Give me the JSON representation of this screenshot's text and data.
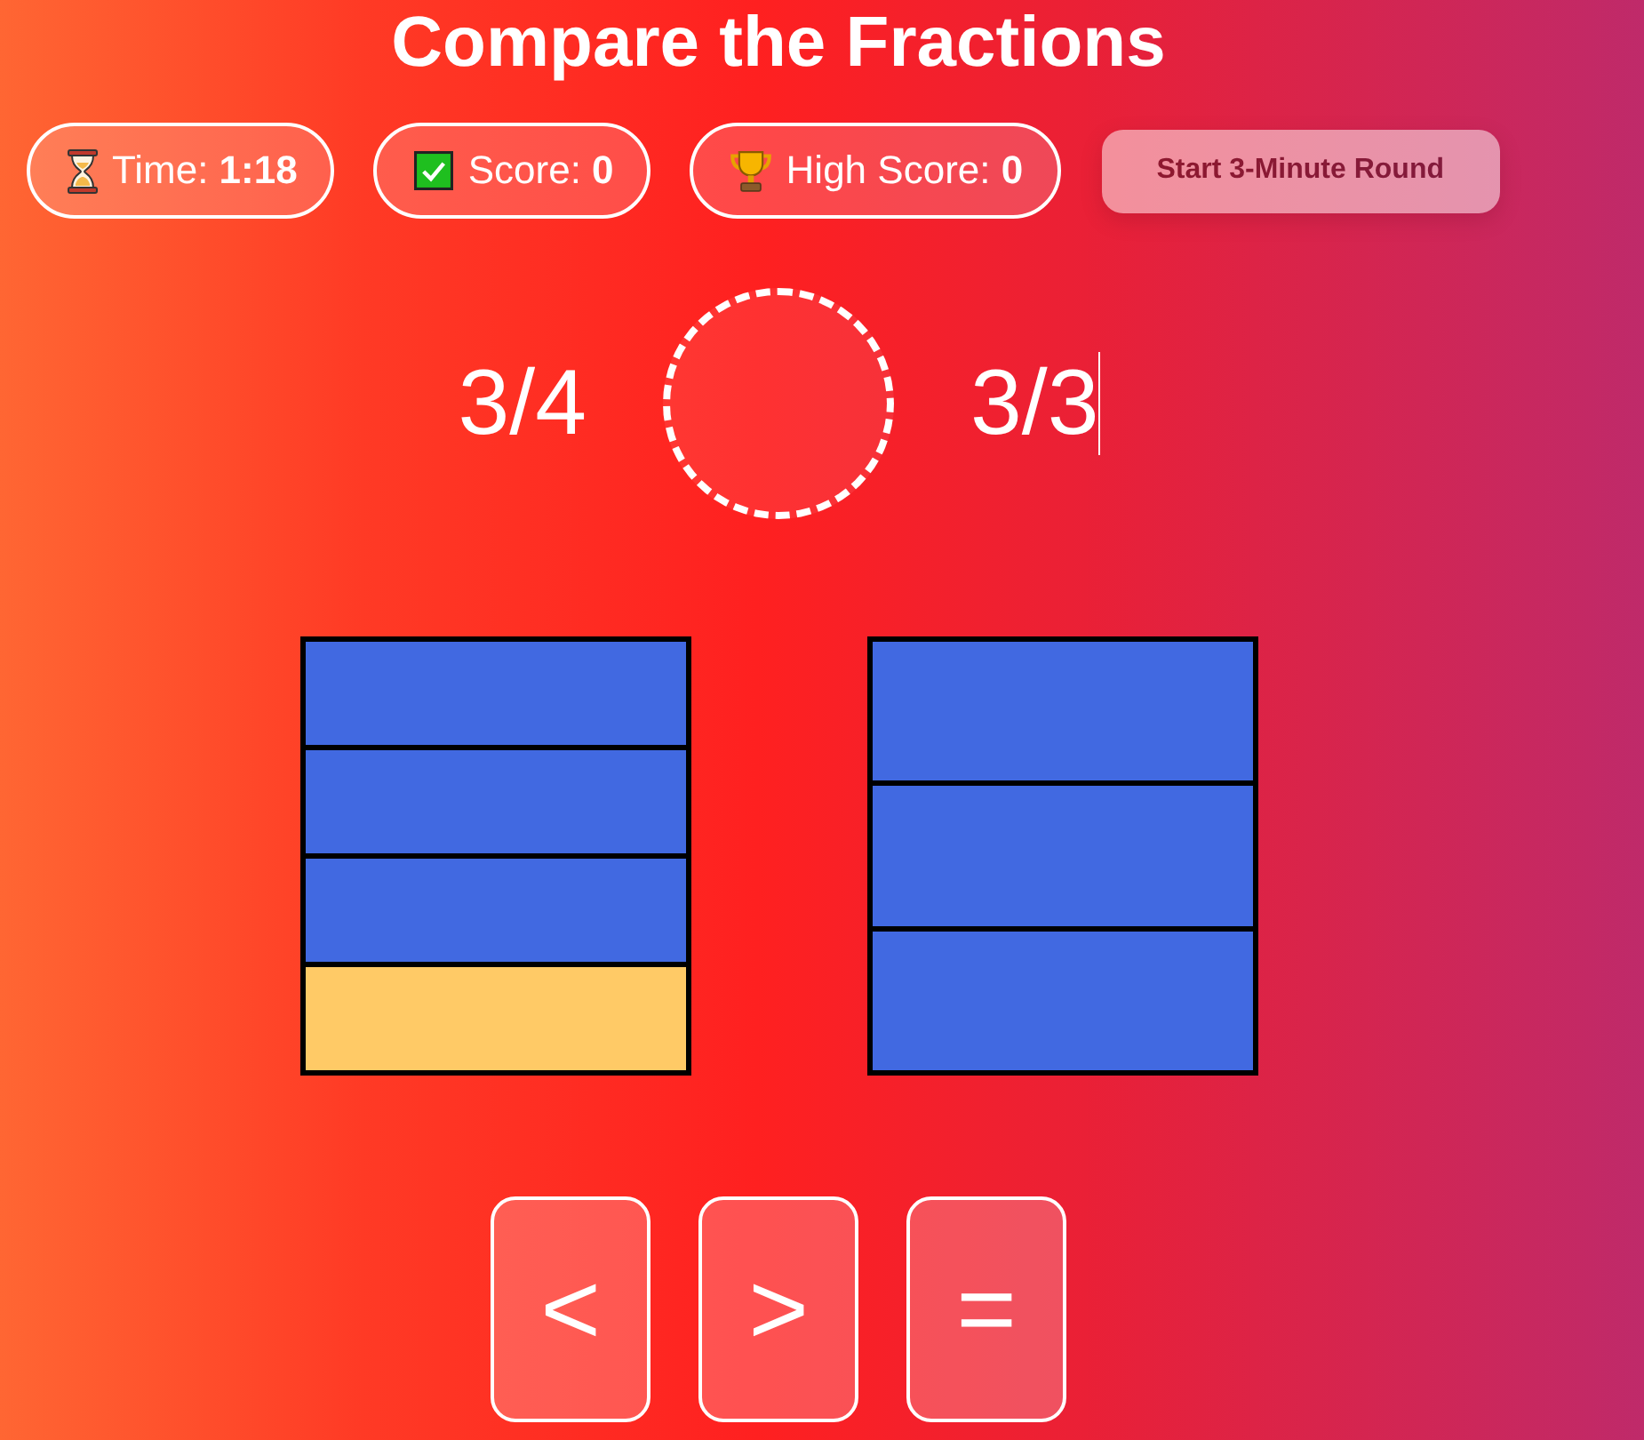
{
  "title": "Compare the Fractions",
  "stats": [
    {
      "kind": "timer",
      "label": "Time:",
      "value": "1:18"
    },
    {
      "kind": "score",
      "label": "Score:",
      "value": "0"
    },
    {
      "kind": "high_score",
      "label": "High Score:",
      "value": "0"
    }
  ],
  "start_button": {
    "label": "Start 3-Minute Round",
    "disabled": true
  },
  "fractions": [
    {
      "text": "3/4",
      "caret": false
    },
    {
      "text": "3/3",
      "caret": true
    }
  ],
  "bars": [
    {
      "segments": [
        {
          "filled": true
        },
        {
          "filled": true
        },
        {
          "filled": true
        },
        {
          "filled": false
        }
      ]
    },
    {
      "segments": [
        {
          "filled": true
        },
        {
          "filled": true
        },
        {
          "filled": true
        }
      ]
    }
  ],
  "choices": [
    "<",
    ">",
    "="
  ]
}
